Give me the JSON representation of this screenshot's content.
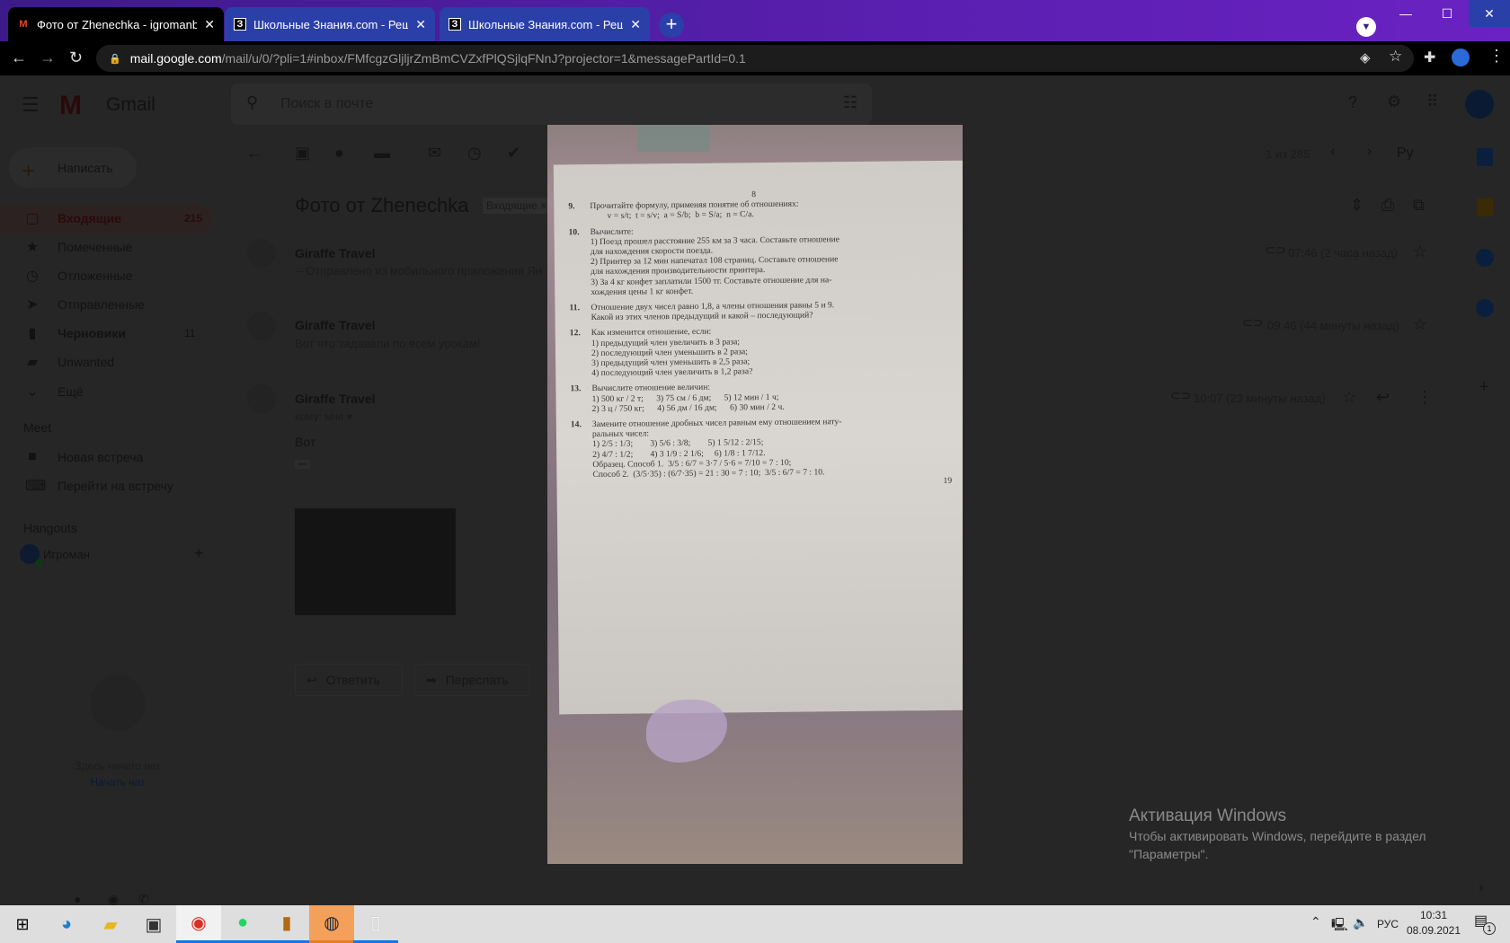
{
  "browser": {
    "tabs": [
      {
        "title": "Фото от Zhenechka - igromanbe",
        "favicon": "M",
        "active": true
      },
      {
        "title": "Школьные Знания.com - Решае",
        "favicon": "З",
        "active": false
      },
      {
        "title": "Школьные Знания.com - Решае",
        "favicon": "З",
        "active": false
      }
    ],
    "close_glyph": "✕",
    "new_tab": "+",
    "url_host": "mail.google.com",
    "url_path": "/mail/u/0/?pli=1#inbox/FMfcgzGljljrZmBmCVZxfPlQSjlqFNnJ?projector=1&messagePartId=0.1"
  },
  "gmail": {
    "app_name": "Gmail",
    "search_placeholder": "Поиск в почте",
    "compose": "Написать",
    "nav": [
      {
        "label": "Входящие",
        "count": "215",
        "icon": "inbox-icon",
        "glyph": "▢"
      },
      {
        "label": "Помеченные",
        "count": "",
        "icon": "star-icon",
        "glyph": "★"
      },
      {
        "label": "Отложенные",
        "count": "",
        "icon": "clock-icon",
        "glyph": "◷"
      },
      {
        "label": "Отправленные",
        "count": "",
        "icon": "send-icon",
        "glyph": "➤"
      },
      {
        "label": "Черновики",
        "count": "11",
        "icon": "draft-icon",
        "glyph": "▮"
      },
      {
        "label": "Unwanted",
        "count": "",
        "icon": "label-icon",
        "glyph": "▰"
      },
      {
        "label": "Ещё",
        "count": "",
        "icon": "chevron-down-icon",
        "glyph": "⌄"
      }
    ],
    "meet": {
      "title": "Meet",
      "items": [
        "Новая встреча",
        "Перейти на встречу"
      ]
    },
    "hangouts": {
      "title": "Hangouts",
      "user": "Игроман",
      "empty": "Здесь ничего нет",
      "start_chat": "Начать чат"
    },
    "pager": "1 из 285",
    "lang": "Ру",
    "subject": "Фото от Zhenechka",
    "subject_label": "Входящие ×",
    "messages": [
      {
        "sender": "Giraffe Travel",
        "snippet": "-- Отправлено из мобильного приложения Ян",
        "time": "07:46 (2 часа назад)"
      },
      {
        "sender": "Giraffe Travel",
        "snippet": "Вот что задавали по всем урокам!",
        "time": "09:46 (44 минуты назад)"
      },
      {
        "sender": "Giraffe Travel",
        "to": "кому: мне ▾",
        "body": "Вот",
        "ellipsis": "•••",
        "time": "10:07 (23 минуты назад)"
      }
    ],
    "reply": "Ответить",
    "forward": "Переслать"
  },
  "photo_text": [
    {
      "n": "",
      "t": "8"
    },
    {
      "n": "9.",
      "t": "Прочитайте формулу, применяя понятие об отношениях:"
    },
    {
      "n": "",
      "t": "        v = s/t;  t = s/v;  a = S/b;  b = S/a;  n = C/a."
    },
    {
      "n": "10.",
      "t": "Вычислите:"
    },
    {
      "n": "",
      "t": "1) Поезд прошел расстояние 255 км за 3 часа. Составьте отношение"
    },
    {
      "n": "",
      "t": "для нахождения скорости поезда."
    },
    {
      "n": "",
      "t": "2) Принтер за 12 мин напечатал 108 страниц. Составьте отношение"
    },
    {
      "n": "",
      "t": "для нахождения производительности принтера."
    },
    {
      "n": "",
      "t": "3) За 4 кг конфет заплатили 1500 тг. Составьте отношение для на-"
    },
    {
      "n": "",
      "t": "хождения цены 1 кг конфет."
    },
    {
      "n": "11.",
      "t": "Отношение двух чисел равно 1,8, а члены отношения равны 5 и 9."
    },
    {
      "n": "",
      "t": "Какой из этих членов предыдущий и какой – последующий?"
    },
    {
      "n": "12.",
      "t": "Как изменится отношение, если:"
    },
    {
      "n": "",
      "t": "1) предыдущий член увеличить в 3 раза;"
    },
    {
      "n": "",
      "t": "2) последующий член уменьшить в 2 раза;"
    },
    {
      "n": "",
      "t": "3) предыдущий член уменьшить в 2,5 раза;"
    },
    {
      "n": "",
      "t": "4) последующий член увеличить в 1,2 раза?"
    },
    {
      "n": "13.",
      "t": "Вычислите отношение величин:"
    },
    {
      "n": "",
      "t": "1) 500 кг / 2 т;      3) 75 см / 6 дм;      5) 12 мин / 1 ч;"
    },
    {
      "n": "",
      "t": "2) 3 ц / 750 кг;      4) 56 дм / 16 дм;      6) 30 мин / 2 ч."
    },
    {
      "n": "14.",
      "t": "Замените отношение дробных чисел равным ему отношением нату-"
    },
    {
      "n": "",
      "t": "ральных чисел:"
    },
    {
      "n": "",
      "t": "1) 2/5 : 1/3;        3) 5/6 : 3/8;        5) 1 5/12 : 2/15;"
    },
    {
      "n": "",
      "t": "2) 4/7 : 1/2;        4) 3 1/9 : 2 1/6;     6) 1/8 : 1 7/12."
    },
    {
      "n": "",
      "t": "Образец. Способ 1.  3/5 : 6/7 = 3·7 / 5·6 = 7/10 = 7 : 10;"
    },
    {
      "n": "",
      "t": "Способ 2.  (3/5·35) : (6/7·35) = 21 : 30 = 7 : 10;  3/5 : 6/7 = 7 : 10."
    },
    {
      "n": "",
      "t": "19"
    }
  ],
  "watermark": {
    "title": "Активация Windows",
    "line1": "Чтобы активировать Windows, перейдите в раздел",
    "line2": "\"Параметры\"."
  },
  "tray": {
    "lang": "РУС",
    "time": "10:31",
    "date": "08.09.2021",
    "notifications": "1"
  }
}
